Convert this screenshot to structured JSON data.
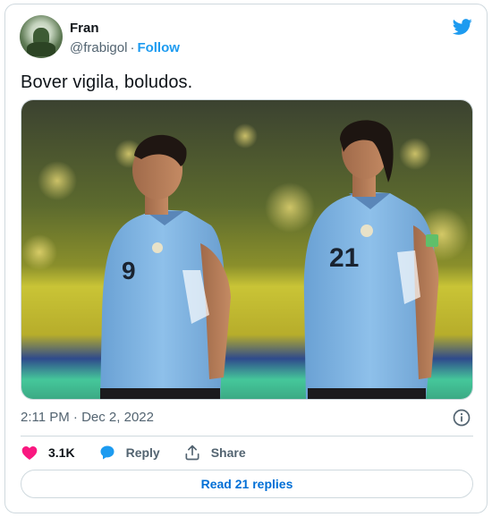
{
  "tweet": {
    "author_name": "Fran",
    "author_handle": "@frabigol",
    "separator": "·",
    "follow_label": "Follow",
    "text": "Bover vigila, boludos.",
    "timestamp": "2:11 PM · Dec 2, 2022"
  },
  "photo": {
    "player_left_number": "9",
    "player_right_number": "21"
  },
  "actions": {
    "like_count": "3.1K",
    "reply_label": "Reply",
    "share_label": "Share"
  },
  "read_replies_label": "Read 21 replies",
  "colors": {
    "twitter_blue": "#1d9bf0",
    "like_red": "#f91880",
    "link_blue": "#006fd6",
    "muted_text": "#536471",
    "jersey_blue": "#7fb5e4"
  },
  "icons": [
    "twitter-bird-icon",
    "info-icon",
    "heart-icon",
    "reply-bubble-icon",
    "share-icon"
  ]
}
